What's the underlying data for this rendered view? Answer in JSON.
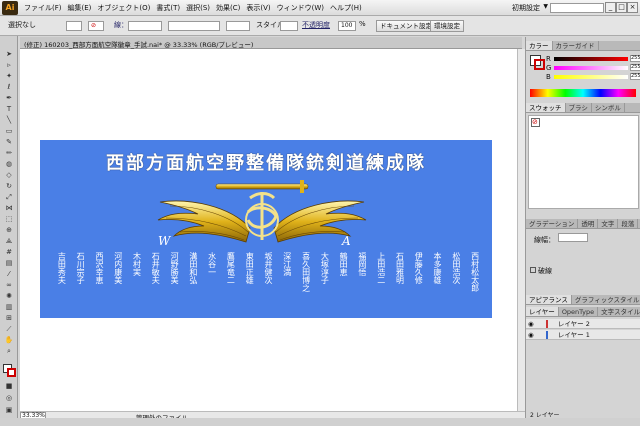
{
  "app": {
    "logo": "Ai",
    "menus": [
      "ファイル(F)",
      "編集(E)",
      "オブジェクト(O)",
      "書式(T)",
      "選択(S)",
      "効果(C)",
      "表示(V)",
      "ウィンドウ(W)",
      "ヘルプ(H)"
    ],
    "workspace": "初期設定",
    "window_buttons": [
      "_",
      "□",
      "×"
    ]
  },
  "control": {
    "selection": "選択なし",
    "stroke_label": "線：",
    "style_label": "スタイル：",
    "opacity_label": "不透明度",
    "opacity_value": "100",
    "opacity_unit": "%",
    "doc_settings": "ドキュメント設定",
    "prefs": "環境設定"
  },
  "document": {
    "tab": "(修正) 160203_西部方面航空隊徽章_手試.nai* @ 33.33% (RGB/プレビュー)",
    "zoom": "33.33%",
    "status": "管理外のファイル"
  },
  "artwork": {
    "title": "西部方面航空野整備隊銃剣道練成隊",
    "letters": [
      "W",
      "A"
    ],
    "names": [
      "西村松太郎",
      "松田浩次",
      "本多康雄",
      "伊藤久修",
      "石田雅明",
      "上田浩二",
      "福岡悟",
      "鶴田恵",
      "大塚淳子",
      "喜久田博之",
      "深江満",
      "坂井健次",
      "東田正雄",
      "鷹尾竜二",
      "水谷一",
      "溝田和弘",
      "河野勝美",
      "石井敏夫",
      "木村実",
      "河内康美",
      "西沢幸恵",
      "石川宗子",
      "吉田秀夫"
    ]
  },
  "panels": {
    "color": {
      "tabs": [
        "カラー",
        "カラーガイド"
      ],
      "channels": [
        {
          "label": "R",
          "value": "255"
        },
        {
          "label": "G",
          "value": "255"
        },
        {
          "label": "B",
          "value": "255"
        }
      ]
    },
    "swatches": {
      "tabs": [
        "スウォッチ",
        "ブラシ",
        "シンボル"
      ]
    },
    "stroke": {
      "tabs": [
        "グラデーション",
        "透明",
        "文字",
        "段落"
      ],
      "weight_label": "線幅：",
      "dashed_label": "破線"
    },
    "appearance": {
      "tabs": [
        "アピアランス",
        "グラフィックスタイル"
      ]
    },
    "layers": {
      "tabs": [
        "レイヤー",
        "OpenType",
        "文字スタイル",
        "段落"
      ],
      "items": [
        "レイヤー 2",
        "レイヤー 1"
      ],
      "count": "2 レイヤー"
    },
    "accent": "#4a7fe6"
  }
}
